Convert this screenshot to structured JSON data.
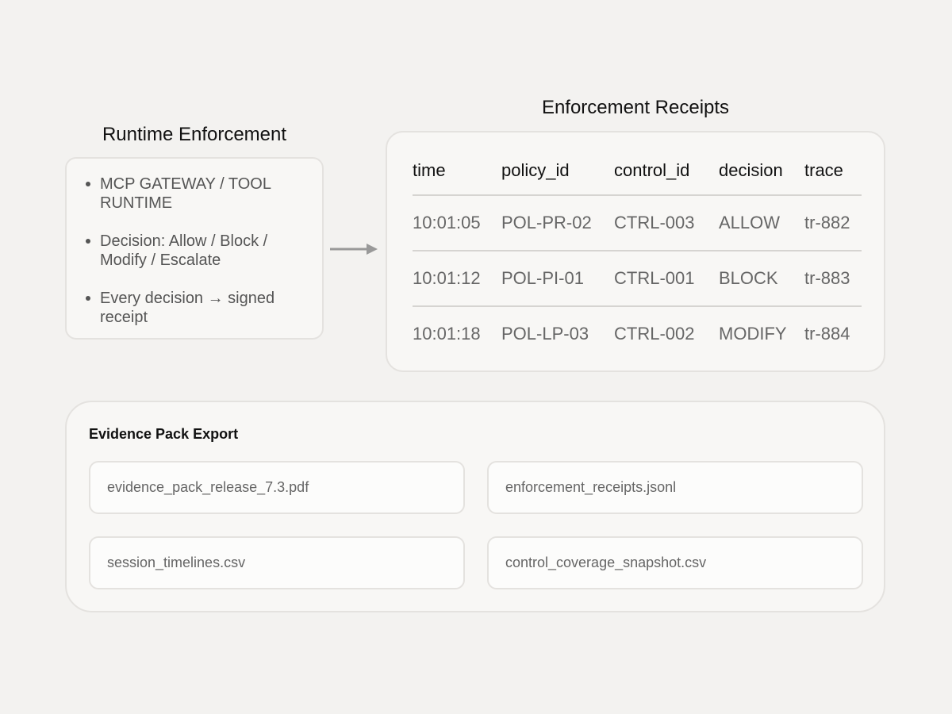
{
  "runtime": {
    "title": "Runtime Enforcement",
    "items": [
      "MCP GATEWAY / TOOL RUNTIME",
      "Decision: Allow / Block / Modify / Escalate",
      "Every decision → signed receipt"
    ]
  },
  "receipts": {
    "title": "Enforcement Receipts",
    "columns": [
      "time",
      "policy_id",
      "control_id",
      "decision",
      "trace"
    ],
    "rows": [
      [
        "10:01:05",
        "POL-PR-02",
        "CTRL-003",
        "ALLOW",
        "tr-882"
      ],
      [
        "10:01:12",
        "POL-PI-01",
        "CTRL-001",
        "BLOCK",
        "tr-883"
      ],
      [
        "10:01:18",
        "POL-LP-03",
        "CTRL-002",
        "MODIFY",
        "tr-884"
      ]
    ]
  },
  "evidence": {
    "title": "Evidence Pack Export",
    "files": [
      "evidence_pack_release_7.3.pdf",
      "enforcement_receipts.jsonl",
      "session_timelines.csv",
      "control_coverage_snapshot.csv"
    ]
  },
  "icons": {
    "flow_arrow": "arrow-right-icon"
  },
  "colors": {
    "background": "#f3f2f0",
    "card": "#f8f7f5",
    "border": "#e4e2df",
    "muted_text": "#666666",
    "arrow": "#999999"
  }
}
